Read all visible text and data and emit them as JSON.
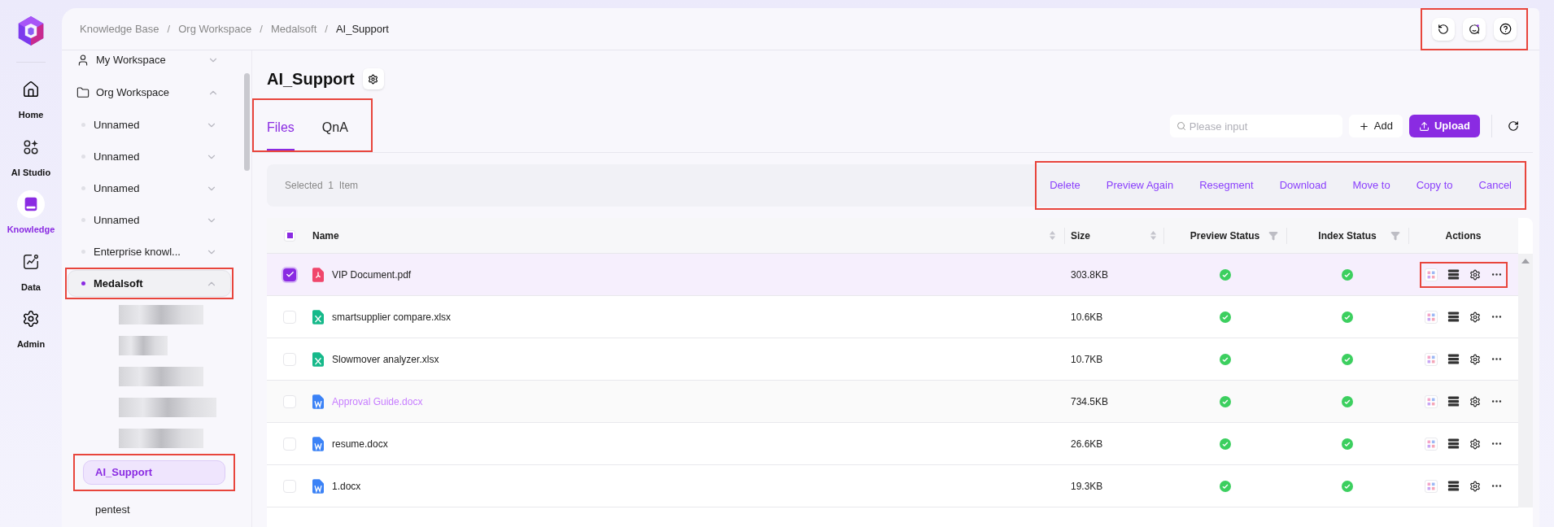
{
  "nav_rail": [
    {
      "label": "Home",
      "selected": false
    },
    {
      "label": "AI Studio",
      "selected": false
    },
    {
      "label": "Knowledge",
      "selected": true
    },
    {
      "label": "Data",
      "selected": false
    },
    {
      "label": "Admin",
      "selected": false
    }
  ],
  "breadcrumb": {
    "items": [
      "Knowledge Base",
      "Org Workspace",
      "Medalsoft",
      "AI_Support"
    ],
    "separators": [
      "/",
      "/",
      "/"
    ]
  },
  "header_actions": {
    "framed": true
  },
  "tree": [
    {
      "label": "My Workspace",
      "kind": "workspace",
      "expanded": false,
      "selected": false,
      "framed": false
    },
    {
      "label": "Org Workspace",
      "kind": "folder",
      "expanded": true,
      "selected": false,
      "framed": false,
      "children": [
        {
          "label": "Unnamed",
          "kind": "group",
          "expanded": false,
          "selected": false,
          "framed": false
        },
        {
          "label": "Unnamed",
          "kind": "group",
          "expanded": false,
          "selected": false,
          "framed": false
        },
        {
          "label": "Unnamed",
          "kind": "group",
          "expanded": false,
          "selected": false,
          "framed": false
        },
        {
          "label": "Unnamed",
          "kind": "group",
          "expanded": false,
          "selected": false,
          "framed": false
        },
        {
          "label": "Enterprise knowl...",
          "kind": "group",
          "expanded": false,
          "selected": false,
          "framed": false
        },
        {
          "label": "Medalsoft",
          "kind": "group",
          "expanded": true,
          "selected": true,
          "framed": true,
          "children": [
            {
              "kind": "redacted"
            },
            {
              "kind": "redacted"
            },
            {
              "kind": "redacted"
            },
            {
              "kind": "redacted"
            },
            {
              "kind": "redacted"
            },
            {
              "label": "AI_Support",
              "kind": "base",
              "selected": true,
              "framed": true
            },
            {
              "label": "pentest",
              "kind": "base",
              "selected": false,
              "framed": false
            }
          ]
        }
      ]
    }
  ],
  "title": "AI_Support",
  "tabs": {
    "framed": true,
    "items": [
      {
        "label": "Files",
        "selected": true
      },
      {
        "label": "QnA",
        "selected": false
      }
    ]
  },
  "search": {
    "placeholder": "Please input"
  },
  "add_button": "Add",
  "upload_button": "Upload",
  "selection_bar": {
    "prefix": "Selected",
    "count": "1",
    "suffix": "Item",
    "framed": true,
    "actions": [
      "Delete",
      "Preview Again",
      "Resegment",
      "Download",
      "Move to",
      "Copy to",
      "Cancel"
    ]
  },
  "table": {
    "select_all": {
      "indeterminate": true
    },
    "columns": [
      {
        "label": "Name",
        "kind": "sortable"
      },
      {
        "label": "Size",
        "kind": "sortable"
      },
      {
        "label": "Preview Status",
        "kind": "filterable"
      },
      {
        "label": "Index Status",
        "kind": "filterable"
      },
      {
        "label": "Actions",
        "kind": "plain"
      }
    ],
    "rows": [
      {
        "name": "VIP Document.pdf",
        "kind": "pdf",
        "size": "303.8KB",
        "preview_ok": true,
        "index_ok": true,
        "selected": true,
        "hovered": false,
        "actions_framed": true
      },
      {
        "name": "smartsupplier compare.xlsx",
        "kind": "sheet",
        "size": "10.6KB",
        "preview_ok": true,
        "index_ok": true,
        "selected": false,
        "hovered": false,
        "actions_framed": false
      },
      {
        "name": "Slowmover analyzer.xlsx",
        "kind": "sheet",
        "size": "10.7KB",
        "preview_ok": true,
        "index_ok": true,
        "selected": false,
        "hovered": false,
        "actions_framed": false
      },
      {
        "name": "Approval Guide.docx",
        "kind": "doc",
        "size": "734.5KB",
        "preview_ok": true,
        "index_ok": true,
        "selected": false,
        "hovered": true,
        "actions_framed": false
      },
      {
        "name": "resume.docx",
        "kind": "doc",
        "size": "26.6KB",
        "preview_ok": true,
        "index_ok": true,
        "selected": false,
        "hovered": false,
        "actions_framed": false
      },
      {
        "name": "1.docx",
        "kind": "doc",
        "size": "19.3KB",
        "preview_ok": true,
        "index_ok": true,
        "selected": false,
        "hovered": false,
        "actions_framed": false
      }
    ]
  }
}
